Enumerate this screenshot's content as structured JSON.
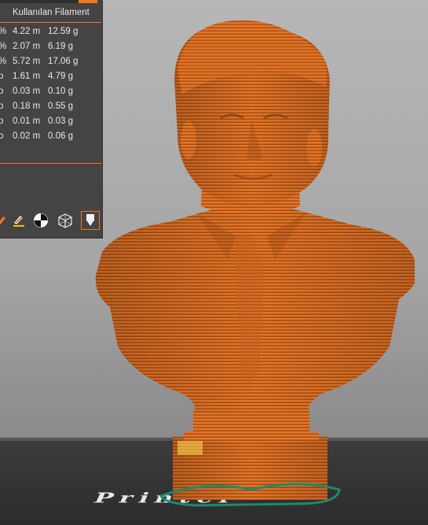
{
  "stats_panel": {
    "column_header": "Kullanılan Filament",
    "rows": [
      {
        "percent": "%",
        "length": "4.22 m",
        "weight": "12.59 g"
      },
      {
        "percent": "%",
        "length": "2.07 m",
        "weight": "6.19 g"
      },
      {
        "percent": "%",
        "length": "5.72 m",
        "weight": "17.06 g"
      },
      {
        "percent": "o",
        "length": "1.61 m",
        "weight": "4.79 g"
      },
      {
        "percent": "o",
        "length": "0.03 m",
        "weight": "0.10 g"
      },
      {
        "percent": "o",
        "length": "0.18 m",
        "weight": "0.55 g"
      },
      {
        "percent": "o",
        "length": "0.01 m",
        "weight": "0.03 g"
      },
      {
        "percent": "o",
        "length": "0.02 m",
        "weight": "0.06 g"
      }
    ]
  },
  "toolbar_icons": [
    "brush-icon",
    "paint-icon",
    "color-wheel-icon",
    "wireframe-cube-icon",
    "extruder-view-icon"
  ],
  "colors": {
    "model_orange": "#e0732a",
    "accent": "#ef7622",
    "panel_bg": "#444444",
    "bed": "#333333"
  },
  "bed": {
    "logo_text": "Printer"
  }
}
